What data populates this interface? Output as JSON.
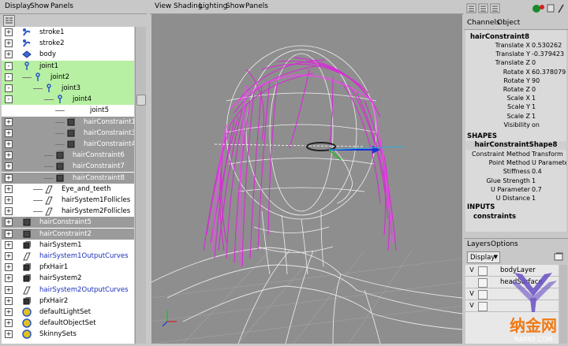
{
  "outliner": {
    "menu": [
      "Display",
      "Show",
      "Panels"
    ],
    "rows": [
      {
        "label": "stroke1",
        "indent": 0,
        "icon": "stroke",
        "state": "",
        "exp": "+",
        "color": ""
      },
      {
        "label": "stroke2",
        "indent": 0,
        "icon": "stroke",
        "state": "",
        "exp": "+",
        "color": ""
      },
      {
        "label": "body",
        "indent": 0,
        "icon": "mesh",
        "state": "",
        "exp": "+",
        "color": ""
      },
      {
        "label": "joint1",
        "indent": 0,
        "icon": "joint",
        "state": "green",
        "exp": "-",
        "color": ""
      },
      {
        "label": "joint2",
        "indent": 1,
        "icon": "joint",
        "state": "green",
        "exp": "-",
        "color": ""
      },
      {
        "label": "joint3",
        "indent": 2,
        "icon": "joint",
        "state": "green",
        "exp": "-",
        "color": ""
      },
      {
        "label": "joint4",
        "indent": 3,
        "icon": "joint",
        "state": "green",
        "exp": "-",
        "color": ""
      },
      {
        "label": "joint5",
        "indent": 4,
        "icon": "none",
        "state": "",
        "exp": "",
        "color": ""
      },
      {
        "label": "hairConstraint1",
        "indent": 4,
        "icon": "constraint",
        "state": "gray",
        "exp": "+",
        "color": "white"
      },
      {
        "label": "hairConstraint3",
        "indent": 4,
        "icon": "constraint",
        "state": "gray",
        "exp": "+",
        "color": "white"
      },
      {
        "label": "hairConstraint4",
        "indent": 4,
        "icon": "constraint",
        "state": "gray",
        "exp": "+",
        "color": "white"
      },
      {
        "label": "hairConstraint6",
        "indent": 3,
        "icon": "constraint",
        "state": "gray",
        "exp": "+",
        "color": "white"
      },
      {
        "label": "hairConstraint7",
        "indent": 3,
        "icon": "constraint",
        "state": "gray",
        "exp": "+",
        "color": "white"
      },
      {
        "label": "hairConstraint8",
        "indent": 3,
        "icon": "constraint",
        "state": "gray",
        "exp": "+",
        "color": "white"
      },
      {
        "label": "Eye_and_teeth",
        "indent": 2,
        "icon": "curve",
        "state": "",
        "exp": "+",
        "color": ""
      },
      {
        "label": "hairSystem1Follicles",
        "indent": 2,
        "icon": "curve",
        "state": "",
        "exp": "+",
        "color": ""
      },
      {
        "label": "hairSystem2Follicles",
        "indent": 2,
        "icon": "curve",
        "state": "",
        "exp": "+",
        "color": ""
      },
      {
        "label": "hairConstraint5",
        "indent": 0,
        "icon": "constraint",
        "state": "gray",
        "exp": "+",
        "color": "white"
      },
      {
        "label": "hairConstraint2",
        "indent": 0,
        "icon": "constraint",
        "state": "gray",
        "exp": "+",
        "color": "white"
      },
      {
        "label": "hairSystem1",
        "indent": 0,
        "icon": "cube",
        "state": "",
        "exp": "+",
        "color": ""
      },
      {
        "label": "hairSystem1OutputCurves",
        "indent": 0,
        "icon": "curve",
        "state": "",
        "exp": "+",
        "color": "blue"
      },
      {
        "label": "pfxHair1",
        "indent": 0,
        "icon": "cube",
        "state": "",
        "exp": "+",
        "color": ""
      },
      {
        "label": "hairSystem2",
        "indent": 0,
        "icon": "cube",
        "state": "",
        "exp": "+",
        "color": ""
      },
      {
        "label": "hairSystem2OutputCurves",
        "indent": 0,
        "icon": "curve",
        "state": "",
        "exp": "+",
        "color": "blue"
      },
      {
        "label": "pfxHair2",
        "indent": 0,
        "icon": "cube",
        "state": "",
        "exp": "+",
        "color": ""
      },
      {
        "label": "defaultLightSet",
        "indent": 0,
        "icon": "set",
        "state": "",
        "exp": "+",
        "color": ""
      },
      {
        "label": "defaultObjectSet",
        "indent": 0,
        "icon": "set",
        "state": "",
        "exp": "+",
        "color": ""
      },
      {
        "label": "SkinnySets",
        "indent": 0,
        "icon": "set",
        "state": "",
        "exp": "+",
        "color": ""
      }
    ]
  },
  "viewport": {
    "menu": [
      "View",
      "Shading",
      "Lighting",
      "Show",
      "Panels"
    ],
    "hair_color": "#e020e0",
    "bg_color": "#8e8e8e"
  },
  "channelbox": {
    "menu": [
      "Channels",
      "Object"
    ],
    "object_name": "hairConstraint8",
    "attributes": [
      {
        "name": "Translate X",
        "value": "0.530262"
      },
      {
        "name": "Translate Y",
        "value": "-0.379423"
      },
      {
        "name": "Translate Z",
        "value": "0"
      },
      {
        "name": "Rotate X",
        "value": "60.378079"
      },
      {
        "name": "Rotate Y",
        "value": "90"
      },
      {
        "name": "Rotate Z",
        "value": "0"
      },
      {
        "name": "Scale X",
        "value": "1"
      },
      {
        "name": "Scale Y",
        "value": "1"
      },
      {
        "name": "Scale Z",
        "value": "1"
      },
      {
        "name": "Visibility",
        "value": "on"
      }
    ],
    "shapes_label": "SHAPES",
    "shape_name": "hairConstraintShape8",
    "shape_attributes": [
      {
        "name": "Constraint Method",
        "value": "Transform"
      },
      {
        "name": "Point Method",
        "value": "U Parameter"
      },
      {
        "name": "Stiffness",
        "value": "0.4"
      },
      {
        "name": "Glue Strength",
        "value": "1"
      },
      {
        "name": "U Parameter",
        "value": "0.7"
      },
      {
        "name": "U Distance",
        "value": "1"
      }
    ],
    "inputs_label": "INPUTS",
    "input_name": "constraints"
  },
  "layers": {
    "menu": [
      "Layers",
      "Options"
    ],
    "display_label": "Display",
    "rows": [
      {
        "v": "V",
        "name": "bodyLayer"
      },
      {
        "v": "",
        "name": "headSurface"
      },
      {
        "v": "V",
        "name": ""
      },
      {
        "v": "V",
        "name": ""
      }
    ]
  },
  "watermark": {
    "text": "纳金网",
    "url": "NARKII.COM"
  }
}
